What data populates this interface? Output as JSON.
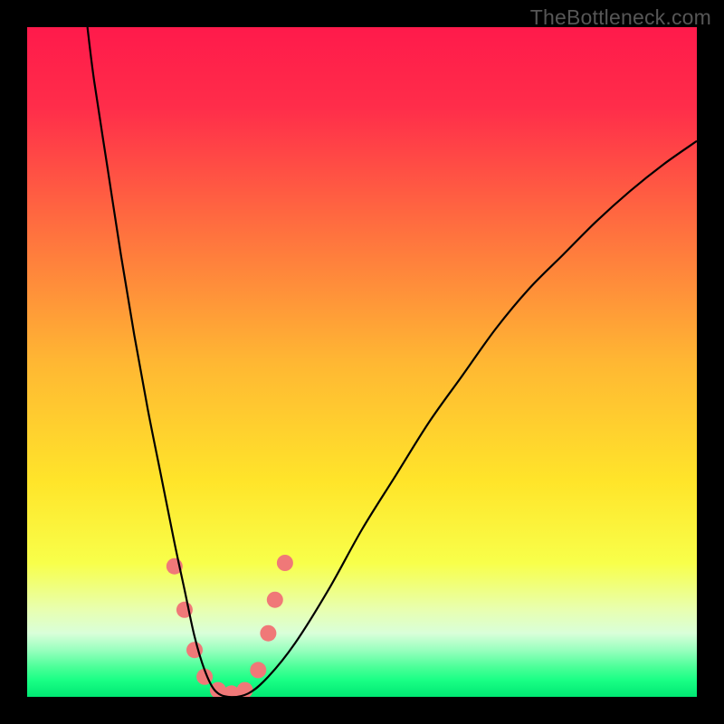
{
  "watermark": "TheBottleneck.com",
  "chart_data": {
    "type": "line",
    "title": "",
    "xlabel": "",
    "ylabel": "",
    "xlim": [
      0,
      100
    ],
    "ylim": [
      0,
      100
    ],
    "grid": false,
    "background": {
      "type": "vertical-gradient",
      "stops": [
        {
          "pos": 0.0,
          "color": "#ff1a4b"
        },
        {
          "pos": 0.12,
          "color": "#ff2d4a"
        },
        {
          "pos": 0.3,
          "color": "#ff6f3f"
        },
        {
          "pos": 0.5,
          "color": "#ffb733"
        },
        {
          "pos": 0.68,
          "color": "#ffe52a"
        },
        {
          "pos": 0.8,
          "color": "#f8ff4a"
        },
        {
          "pos": 0.87,
          "color": "#e8ffb0"
        },
        {
          "pos": 0.905,
          "color": "#d9ffd9"
        },
        {
          "pos": 0.93,
          "color": "#99ffbf"
        },
        {
          "pos": 0.955,
          "color": "#4dff99"
        },
        {
          "pos": 0.975,
          "color": "#1aff85"
        },
        {
          "pos": 1.0,
          "color": "#00e873"
        }
      ]
    },
    "series": [
      {
        "name": "bottleneck-curve",
        "color": "#000000",
        "x": [
          9,
          10,
          12,
          14,
          16,
          18,
          20,
          22,
          23.5,
          25,
          26.5,
          28,
          30,
          33,
          36,
          40,
          45,
          50,
          55,
          60,
          65,
          70,
          75,
          80,
          85,
          90,
          95,
          100
        ],
        "y": [
          100,
          92,
          79,
          66,
          54,
          43,
          33,
          23,
          16,
          9,
          4,
          1,
          0,
          0.5,
          3,
          8,
          16,
          25,
          33,
          41,
          48,
          55,
          61,
          66,
          71,
          75.5,
          79.5,
          83
        ]
      }
    ],
    "markers": [
      {
        "name": "highlight-dots",
        "color": "#f07878",
        "radius": 9,
        "points": [
          {
            "x": 22.0,
            "y": 19.5
          },
          {
            "x": 23.5,
            "y": 13.0
          },
          {
            "x": 25.0,
            "y": 7.0
          },
          {
            "x": 26.5,
            "y": 3.0
          },
          {
            "x": 28.5,
            "y": 1.0
          },
          {
            "x": 30.5,
            "y": 0.5
          },
          {
            "x": 32.5,
            "y": 1.0
          },
          {
            "x": 34.5,
            "y": 4.0
          },
          {
            "x": 36.0,
            "y": 9.5
          },
          {
            "x": 37.0,
            "y": 14.5
          },
          {
            "x": 38.5,
            "y": 20.0
          }
        ]
      }
    ]
  }
}
